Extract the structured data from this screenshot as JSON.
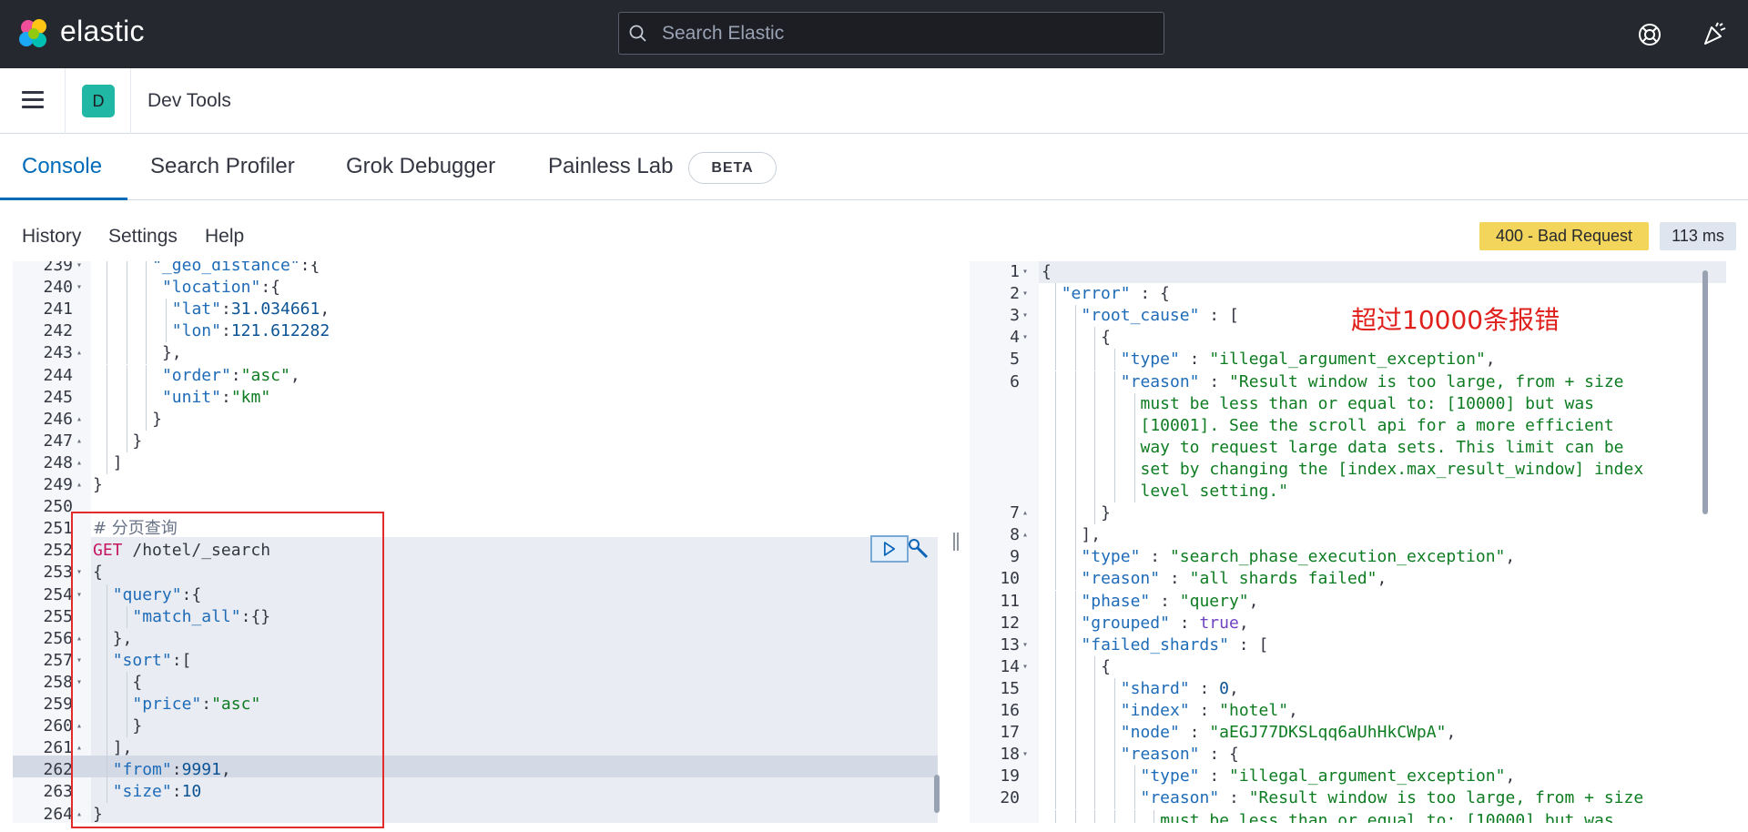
{
  "app": {
    "logo_text": "elastic",
    "search_placeholder": "Search Elastic",
    "icons": [
      "elastic-logo-icon",
      "search-icon",
      "help-icon",
      "newsfeed-icon",
      "hamburger-menu-icon"
    ]
  },
  "space_badge": "D",
  "breadcrumb": "Dev Tools",
  "tabs": [
    {
      "label": "Console",
      "active": true
    },
    {
      "label": "Search Profiler",
      "active": false
    },
    {
      "label": "Grok Debugger",
      "active": false
    },
    {
      "label": "Painless Lab",
      "active": false
    }
  ],
  "beta_badge": "BETA",
  "toolbar": {
    "history": "History",
    "settings": "Settings",
    "help": "Help",
    "status": "400 - Bad Request",
    "duration": "113 ms"
  },
  "annotation": "超过10000条报错",
  "colors": {
    "status_badge": "#f3d55b",
    "accent": "#006bb8",
    "annotation": "#e0201c"
  },
  "request_lines": [
    {
      "n": "239",
      "fold": "▾",
      "indent": 6,
      "html": "<span class=\"k\">\"_geo_distance\"</span><span class=\"p\">:{</span>"
    },
    {
      "n": "240",
      "fold": "▾",
      "indent": 7,
      "html": "<span class=\"k\">\"location\"</span><span class=\"p\">:{</span>"
    },
    {
      "n": "241",
      "fold": "",
      "indent": 8,
      "html": "<span class=\"k\">\"lat\"</span><span class=\"p\">:</span><span class=\"n\">31.034661</span><span class=\"p\">,</span>"
    },
    {
      "n": "242",
      "fold": "",
      "indent": 8,
      "html": "<span class=\"k\">\"lon\"</span><span class=\"p\">:</span><span class=\"n\">121.612282</span>"
    },
    {
      "n": "243",
      "fold": "▴",
      "indent": 7,
      "html": "<span class=\"p\">},</span>"
    },
    {
      "n": "244",
      "fold": "",
      "indent": 7,
      "html": "<span class=\"k\">\"order\"</span><span class=\"p\">:</span><span class=\"s\">\"asc\"</span><span class=\"p\">,</span>"
    },
    {
      "n": "245",
      "fold": "",
      "indent": 7,
      "html": "<span class=\"k\">\"unit\"</span><span class=\"p\">:</span><span class=\"s\">\"km\"</span>"
    },
    {
      "n": "246",
      "fold": "▴",
      "indent": 6,
      "html": "<span class=\"p\">}</span>"
    },
    {
      "n": "247",
      "fold": "▴",
      "indent": 4,
      "html": "<span class=\"p\">}</span>"
    },
    {
      "n": "248",
      "fold": "▴",
      "indent": 2,
      "html": "<span class=\"p\">]</span>"
    },
    {
      "n": "249",
      "fold": "▴",
      "indent": 0,
      "html": "<span class=\"p\">}</span>"
    },
    {
      "n": "250",
      "fold": "",
      "indent": 0,
      "html": ""
    },
    {
      "n": "251",
      "fold": "",
      "indent": 0,
      "html": "<span class=\"cm\"># 分页查询</span>"
    },
    {
      "n": "252",
      "fold": "",
      "indent": 0,
      "html": "<span class=\"kw\">GET</span><span class=\"p\"> /hotel/_search</span>"
    },
    {
      "n": "253",
      "fold": "▾",
      "indent": 0,
      "html": "<span class=\"p\">{</span>"
    },
    {
      "n": "254",
      "fold": "▾",
      "indent": 2,
      "html": "<span class=\"k\">\"query\"</span><span class=\"p\">:{</span>"
    },
    {
      "n": "255",
      "fold": "",
      "indent": 4,
      "html": "<span class=\"k\">\"match_all\"</span><span class=\"p\">:{}</span>"
    },
    {
      "n": "256",
      "fold": "▴",
      "indent": 2,
      "html": "<span class=\"p\">},</span>"
    },
    {
      "n": "257",
      "fold": "▾",
      "indent": 2,
      "html": "<span class=\"k\">\"sort\"</span><span class=\"p\">:[</span>"
    },
    {
      "n": "258",
      "fold": "▾",
      "indent": 4,
      "html": "<span class=\"p\">{</span>"
    },
    {
      "n": "259",
      "fold": "",
      "indent": 4,
      "html": "<span class=\"k\">\"price\"</span><span class=\"p\">:</span><span class=\"s\">\"asc\"</span>"
    },
    {
      "n": "260",
      "fold": "▴",
      "indent": 4,
      "html": "<span class=\"p\">}</span>"
    },
    {
      "n": "261",
      "fold": "▴",
      "indent": 2,
      "html": "<span class=\"p\">],</span>"
    },
    {
      "n": "262",
      "fold": "",
      "indent": 2,
      "html": "<span class=\"k\">\"from\"</span><span class=\"p\">:</span><span class=\"n\">9991</span><span class=\"p\">,</span>"
    },
    {
      "n": "263",
      "fold": "",
      "indent": 2,
      "html": "<span class=\"k\">\"size\"</span><span class=\"p\">:</span><span class=\"n\">10</span>"
    },
    {
      "n": "264",
      "fold": "▴",
      "indent": 0,
      "html": "<span class=\"p\">}</span>"
    }
  ],
  "response_lines": [
    {
      "n": "1",
      "fold": "▾",
      "indent": 0,
      "html": "<span class=\"p\">{</span>"
    },
    {
      "n": "2",
      "fold": "▾",
      "indent": 2,
      "html": "<span class=\"k\">\"error\"</span><span class=\"p\"> : {</span>"
    },
    {
      "n": "3",
      "fold": "▾",
      "indent": 4,
      "html": "<span class=\"k\">\"root_cause\"</span><span class=\"p\"> : [</span>"
    },
    {
      "n": "4",
      "fold": "▾",
      "indent": 6,
      "html": "<span class=\"p\">{</span>"
    },
    {
      "n": "5",
      "fold": "",
      "indent": 8,
      "html": "<span class=\"k\">\"type\"</span><span class=\"p\"> : </span><span class=\"s\">\"illegal_argument_exception\"</span><span class=\"p\">,</span>"
    },
    {
      "n": "6",
      "fold": "",
      "indent": 8,
      "html": "<span class=\"k\">\"reason\"</span><span class=\"p\"> : </span><span class=\"s\">\"Result window is too large, from + size</span>"
    },
    {
      "n": "",
      "fold": "",
      "indent": 10,
      "html": "<span class=\"s\">must be less than or equal to: [10000] but was</span>"
    },
    {
      "n": "",
      "fold": "",
      "indent": 10,
      "html": "<span class=\"s\">[10001]. See the scroll api for a more efficient</span>"
    },
    {
      "n": "",
      "fold": "",
      "indent": 10,
      "html": "<span class=\"s\">way to request large data sets. This limit can be</span>"
    },
    {
      "n": "",
      "fold": "",
      "indent": 10,
      "html": "<span class=\"s\">set by changing the [index.max_result_window] index</span>"
    },
    {
      "n": "",
      "fold": "",
      "indent": 10,
      "html": "<span class=\"s\">level setting.\"</span>"
    },
    {
      "n": "7",
      "fold": "▴",
      "indent": 6,
      "html": "<span class=\"p\">}</span>"
    },
    {
      "n": "8",
      "fold": "▴",
      "indent": 4,
      "html": "<span class=\"p\">],</span>"
    },
    {
      "n": "9",
      "fold": "",
      "indent": 4,
      "html": "<span class=\"k\">\"type\"</span><span class=\"p\"> : </span><span class=\"s\">\"search_phase_execution_exception\"</span><span class=\"p\">,</span>"
    },
    {
      "n": "10",
      "fold": "",
      "indent": 4,
      "html": "<span class=\"k\">\"reason\"</span><span class=\"p\"> : </span><span class=\"s\">\"all shards failed\"</span><span class=\"p\">,</span>"
    },
    {
      "n": "11",
      "fold": "",
      "indent": 4,
      "html": "<span class=\"k\">\"phase\"</span><span class=\"p\"> : </span><span class=\"s\">\"query\"</span><span class=\"p\">,</span>"
    },
    {
      "n": "12",
      "fold": "",
      "indent": 4,
      "html": "<span class=\"k\">\"grouped\"</span><span class=\"p\"> : </span><span class=\"b\">true</span><span class=\"p\">,</span>"
    },
    {
      "n": "13",
      "fold": "▾",
      "indent": 4,
      "html": "<span class=\"k\">\"failed_shards\"</span><span class=\"p\"> : [</span>"
    },
    {
      "n": "14",
      "fold": "▾",
      "indent": 6,
      "html": "<span class=\"p\">{</span>"
    },
    {
      "n": "15",
      "fold": "",
      "indent": 8,
      "html": "<span class=\"k\">\"shard\"</span><span class=\"p\"> : </span><span class=\"n\">0</span><span class=\"p\">,</span>"
    },
    {
      "n": "16",
      "fold": "",
      "indent": 8,
      "html": "<span class=\"k\">\"index\"</span><span class=\"p\"> : </span><span class=\"s\">\"hotel\"</span><span class=\"p\">,</span>"
    },
    {
      "n": "17",
      "fold": "",
      "indent": 8,
      "html": "<span class=\"k\">\"node\"</span><span class=\"p\"> : </span><span class=\"s\">\"aEGJ77DKSLqq6aUhHkCWpA\"</span><span class=\"p\">,</span>"
    },
    {
      "n": "18",
      "fold": "▾",
      "indent": 8,
      "html": "<span class=\"k\">\"reason\"</span><span class=\"p\"> : {</span>"
    },
    {
      "n": "19",
      "fold": "",
      "indent": 10,
      "html": "<span class=\"k\">\"type\"</span><span class=\"p\"> : </span><span class=\"s\">\"illegal_argument_exception\"</span><span class=\"p\">,</span>"
    },
    {
      "n": "20",
      "fold": "",
      "indent": 10,
      "html": "<span class=\"k\">\"reason\"</span><span class=\"p\"> : </span><span class=\"s\">\"Result window is too large, from + size</span>"
    },
    {
      "n": "",
      "fold": "",
      "indent": 12,
      "html": "<span class=\"s\">must be less than or equal to: [10000] but was</span>"
    }
  ]
}
